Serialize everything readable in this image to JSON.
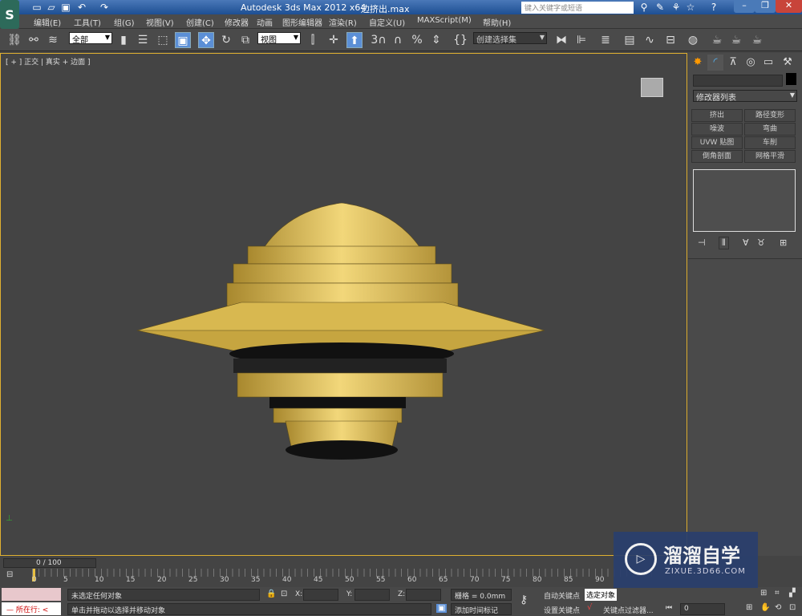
{
  "app": {
    "title": "Autodesk 3ds Max  2012 x64",
    "file": "边挤出.max",
    "logo": "S"
  },
  "search": {
    "placeholder": "键入关键字或短语"
  },
  "menu": [
    "编辑(E)",
    "工具(T)",
    "组(G)",
    "视图(V)",
    "创建(C)",
    "修改器",
    "动画",
    "图形编辑器",
    "渲染(R)",
    "自定义(U)",
    "MAXScript(M)",
    "帮助(H)"
  ],
  "toolbar": {
    "selection_filter": "全部",
    "ref_coord": "视图",
    "named_selection": "创建选择集"
  },
  "viewport": {
    "label": "[ + ] 正交 | 真实 + 边面 ]"
  },
  "panel": {
    "name_value": "",
    "modifier_list": "修改器列表",
    "modifiers": [
      "挤出",
      "路径变形",
      "噪波",
      "弯曲",
      "UVW 贴图",
      "车削",
      "倒角剖面",
      "网格平滑"
    ]
  },
  "timeline": {
    "frame": "0 / 100",
    "ticks": [
      "0",
      "5",
      "10",
      "15",
      "20",
      "25",
      "30",
      "35",
      "40",
      "45",
      "50",
      "55",
      "60",
      "65",
      "70",
      "75",
      "80",
      "85",
      "90"
    ]
  },
  "status": {
    "running": "所在行:",
    "selection": "未选定任何对象",
    "prompt": "单击并拖动以选择并移动对象",
    "x_label": "X:",
    "y_label": "Y:",
    "z_label": "Z:",
    "grid": "栅格 = 0.0mm",
    "add_tag": "添加时间标记",
    "auto_key": "自动关键点",
    "set_key": "设置关键点",
    "selected": "选定对象",
    "key_filter": "关键点过滤器...",
    "frame_value": "0"
  },
  "watermark": {
    "brand": "溜溜自学",
    "url": "ZIXUE.3D66.COM"
  },
  "colors": {
    "accent": "#5b8fd6",
    "object": "#e8c45a",
    "viewport_border": "#e0b030"
  }
}
